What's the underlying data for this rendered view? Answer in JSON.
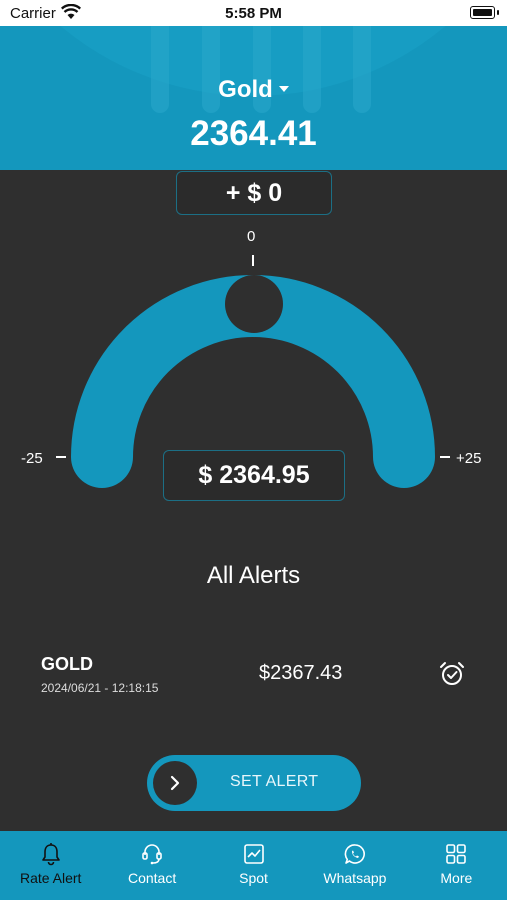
{
  "status_bar": {
    "carrier": "Carrier",
    "time": "5:58 PM"
  },
  "header": {
    "metal": "Gold",
    "price": "2364.41"
  },
  "adjust": {
    "label": "+ $ 0"
  },
  "gauge": {
    "top_tick": "0",
    "left_tick": "-25",
    "right_tick": "+25",
    "min": -25,
    "max": 25,
    "value": 0
  },
  "current_price": {
    "label": "$ 2364.95"
  },
  "alerts": {
    "title": "All Alerts",
    "items": [
      {
        "metal": "GOLD",
        "datetime": "2024/06/21 - 12:18:15",
        "price": "$2367.43"
      }
    ]
  },
  "set_alert": {
    "label": "SET ALERT"
  },
  "tabs": [
    {
      "label": "Rate Alert",
      "icon": "bell-icon"
    },
    {
      "label": "Contact",
      "icon": "headset-icon"
    },
    {
      "label": "Spot",
      "icon": "chart-icon"
    },
    {
      "label": "Whatsapp",
      "icon": "whatsapp-icon"
    },
    {
      "label": "More",
      "icon": "grid-icon"
    }
  ],
  "colors": {
    "accent": "#1497bd",
    "background": "#2f2f2f",
    "box_border": "#1c6f85"
  }
}
